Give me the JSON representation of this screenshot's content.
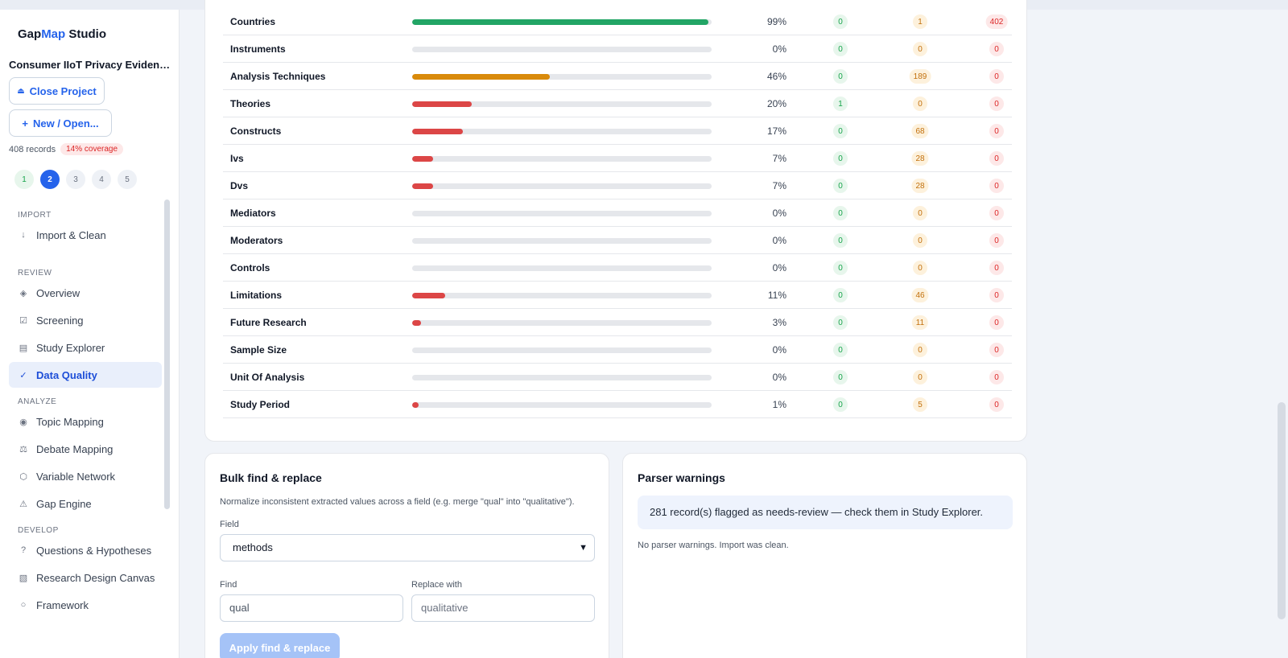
{
  "sidebar": {
    "brand_a": "Gap",
    "brand_b": "Map",
    "brand_c": " Studio",
    "project_name": "Consumer IIoT Privacy Evidence ...",
    "close_project": "Close Project",
    "new_open": "New / Open...",
    "records": "408 records",
    "coverage": "14% coverage",
    "steps": [
      "1",
      "2",
      "3",
      "4",
      "5"
    ],
    "active_step": "2",
    "sections": {
      "import": "IMPORT",
      "review": "REVIEW",
      "analyze": "ANALYZE",
      "develop": "DEVELOP"
    },
    "items": {
      "import_clean": "Import & Clean",
      "overview": "Overview",
      "screening": "Screening",
      "study_explorer": "Study Explorer",
      "data_quality": "Data Quality",
      "topic_mapping": "Topic Mapping",
      "debate_mapping": "Debate Mapping",
      "variable_network": "Variable Network",
      "gap_engine": "Gap Engine",
      "questions_hypotheses": "Questions & Hypotheses",
      "research_design_canvas": "Research Design Canvas",
      "framework": "Framework"
    },
    "icons": {
      "import_clean": "↓",
      "overview": "◈",
      "screening": "☑",
      "study_explorer": "▤",
      "data_quality": "✓",
      "topic_mapping": "◉",
      "debate_mapping": "⚖",
      "variable_network": "⬡",
      "gap_engine": "⚠",
      "questions_hypotheses": "?",
      "research_design_canvas": "▧",
      "framework": "○",
      "close_project": "⏏",
      "new_open": "+"
    }
  },
  "field_coverage": {
    "colors": {
      "green": "#22a565",
      "amber": "#d98a0b",
      "red": "#dc4646"
    },
    "rows": [
      {
        "field": "Countries",
        "pct": "99%",
        "fill": 0.99,
        "color": "green",
        "ok": "0",
        "warn": "1",
        "err": "402"
      },
      {
        "field": "Instruments",
        "pct": "0%",
        "fill": 0,
        "color": "red",
        "ok": "0",
        "warn": "0",
        "err": "0"
      },
      {
        "field": "Analysis Techniques",
        "pct": "46%",
        "fill": 0.46,
        "color": "amber",
        "ok": "0",
        "warn": "189",
        "err": "0"
      },
      {
        "field": "Theories",
        "pct": "20%",
        "fill": 0.2,
        "color": "red",
        "ok": "1",
        "warn": "0",
        "err": "0"
      },
      {
        "field": "Constructs",
        "pct": "17%",
        "fill": 0.17,
        "color": "red",
        "ok": "0",
        "warn": "68",
        "err": "0"
      },
      {
        "field": "Ivs",
        "pct": "7%",
        "fill": 0.07,
        "color": "red",
        "ok": "0",
        "warn": "28",
        "err": "0"
      },
      {
        "field": "Dvs",
        "pct": "7%",
        "fill": 0.07,
        "color": "red",
        "ok": "0",
        "warn": "28",
        "err": "0"
      },
      {
        "field": "Mediators",
        "pct": "0%",
        "fill": 0,
        "color": "red",
        "ok": "0",
        "warn": "0",
        "err": "0"
      },
      {
        "field": "Moderators",
        "pct": "0%",
        "fill": 0,
        "color": "red",
        "ok": "0",
        "warn": "0",
        "err": "0"
      },
      {
        "field": "Controls",
        "pct": "0%",
        "fill": 0,
        "color": "red",
        "ok": "0",
        "warn": "0",
        "err": "0"
      },
      {
        "field": "Limitations",
        "pct": "11%",
        "fill": 0.11,
        "color": "red",
        "ok": "0",
        "warn": "46",
        "err": "0"
      },
      {
        "field": "Future Research",
        "pct": "3%",
        "fill": 0.03,
        "color": "red",
        "ok": "0",
        "warn": "11",
        "err": "0"
      },
      {
        "field": "Sample Size",
        "pct": "0%",
        "fill": 0,
        "color": "red",
        "ok": "0",
        "warn": "0",
        "err": "0"
      },
      {
        "field": "Unit Of Analysis",
        "pct": "0%",
        "fill": 0,
        "color": "red",
        "ok": "0",
        "warn": "0",
        "err": "0"
      },
      {
        "field": "Study Period",
        "pct": "1%",
        "fill": 0.01,
        "color": "red",
        "ok": "0",
        "warn": "5",
        "err": "0"
      }
    ]
  },
  "bulk": {
    "title": "Bulk find & replace",
    "description": "Normalize inconsistent extracted values across a field (e.g. merge \"qual\" into \"qualitative\").",
    "field_label": "Field",
    "field_value": "methods",
    "find_label": "Find",
    "find_value": "qual",
    "replace_label": "Replace with",
    "replace_placeholder": "qualitative",
    "apply_label": "Apply find & replace"
  },
  "parser": {
    "title": "Parser warnings",
    "notice": "281 record(s) flagged as needs-review — check them in Study Explorer.",
    "note": "No parser warnings. Import was clean."
  }
}
